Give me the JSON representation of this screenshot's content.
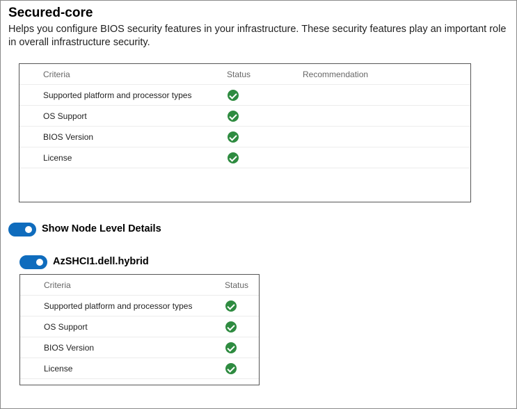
{
  "section": {
    "title": "Secured-core",
    "description": "Helps you configure BIOS security features in your infrastructure. These security features play an important role in overall infrastructure security."
  },
  "cluster_table": {
    "headers": [
      "Criteria",
      "Status",
      "Recommendation"
    ],
    "rows": [
      {
        "criteria": "Supported platform and processor types",
        "status_icon": "check-circle-icon",
        "recommendation": ""
      },
      {
        "criteria": "OS Support",
        "status_icon": "check-circle-icon",
        "recommendation": ""
      },
      {
        "criteria": "BIOS Version",
        "status_icon": "check-circle-icon",
        "recommendation": ""
      },
      {
        "criteria": "License",
        "status_icon": "check-circle-icon",
        "recommendation": ""
      }
    ]
  },
  "node_details_toggle": {
    "label": "Show Node Level Details",
    "on": true
  },
  "node": {
    "name": "AzSHCI1.dell.hybrid",
    "expanded": true,
    "table": {
      "headers": [
        "Criteria",
        "Status"
      ],
      "rows": [
        {
          "criteria": "Supported platform and processor types",
          "status_icon": "check-circle-icon"
        },
        {
          "criteria": "OS Support",
          "status_icon": "check-circle-icon"
        },
        {
          "criteria": "BIOS Version",
          "status_icon": "check-circle-icon"
        },
        {
          "criteria": "License",
          "status_icon": "check-circle-icon"
        }
      ]
    }
  },
  "colors": {
    "accent": "#0f6cbd",
    "success": "#2e8b40"
  }
}
